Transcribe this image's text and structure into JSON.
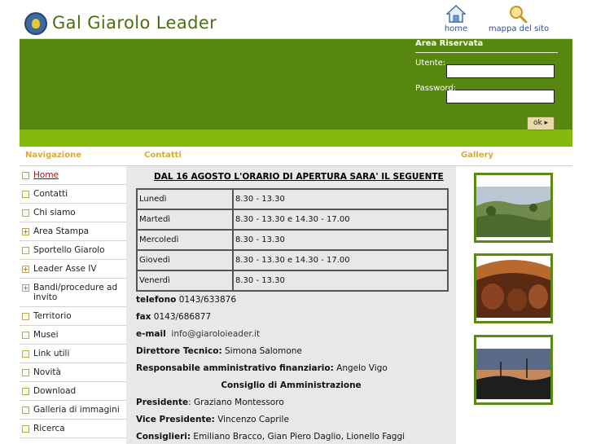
{
  "site": {
    "title": "Gal Giarolo Leader"
  },
  "header_links": {
    "home": "home",
    "sitemap": "mappa del sito"
  },
  "login": {
    "title": "Area Riservata",
    "user_label": "Utente:",
    "password_label": "Password:",
    "user_value": "",
    "password_value": "",
    "submit_label": "ok"
  },
  "sections": {
    "nav": "Navigazione",
    "contacts": "Contatti",
    "gallery": "Gallery"
  },
  "nav": {
    "items": [
      {
        "label": "Home",
        "expand": ""
      },
      {
        "label": "Contatti",
        "expand": ""
      },
      {
        "label": "Chi siamo",
        "expand": ""
      },
      {
        "label": "Area Stampa",
        "expand": "+"
      },
      {
        "label": "Sportello Giarolo",
        "expand": ""
      },
      {
        "label": "Leader Asse IV",
        "expand": "+"
      },
      {
        "label": "Bandi/procedure ad invito",
        "expand": "+"
      },
      {
        "label": "Territorio",
        "expand": ""
      },
      {
        "label": "Musei",
        "expand": ""
      },
      {
        "label": "Link utili",
        "expand": ""
      },
      {
        "label": "Novità",
        "expand": ""
      },
      {
        "label": "Download",
        "expand": ""
      },
      {
        "label": "Galleria di immagini",
        "expand": ""
      },
      {
        "label": "Ricerca",
        "expand": ""
      }
    ]
  },
  "contacts": {
    "notice": "DAL 16 AGOSTO L'ORARIO DI APERTURA SARA' IL SEGUENTE",
    "hours": [
      {
        "day": "Lunedì",
        "time": "8.30 - 13.30"
      },
      {
        "day": "Martedì",
        "time": "8.30 - 13.30 e 14.30 - 17.00"
      },
      {
        "day": "Mercoledì",
        "time": "8.30 - 13.30"
      },
      {
        "day": "Giovedì",
        "time": "8.30 - 13.30 e 14.30 - 17.00"
      },
      {
        "day": "Venerdì",
        "time": "8.30 - 13.30"
      }
    ],
    "phone_label": "telefono",
    "phone": "0143/633876",
    "fax_label": "fax",
    "fax": "0143/686877",
    "email_label": "e-mail",
    "email": "info@giaroloieader.it",
    "director_label": "Direttore Tecnico:",
    "director": "Simona Salomone",
    "admin_label": "Responsabile amministrativo finanziario:",
    "admin": "Angelo Vigo",
    "board_title": "Consiglio di Amministrazione",
    "president_label": "Presidente",
    "president": ": Graziano Montessoro",
    "vice_label": "Vice Presidente:",
    "vice": "Vincenzo Caprile",
    "councillors_label": "Consiglieri:",
    "councillors": "Emiliano Bracco, Gian Piero Daglio, Lionello Faggi"
  },
  "colors": {
    "banner_green": "#588710",
    "strip_green": "#84b90e",
    "title_green": "#4c6e12",
    "section_gold": "#d9a83a",
    "link_blue": "#2a4d9c",
    "active_red": "#9e1010"
  }
}
